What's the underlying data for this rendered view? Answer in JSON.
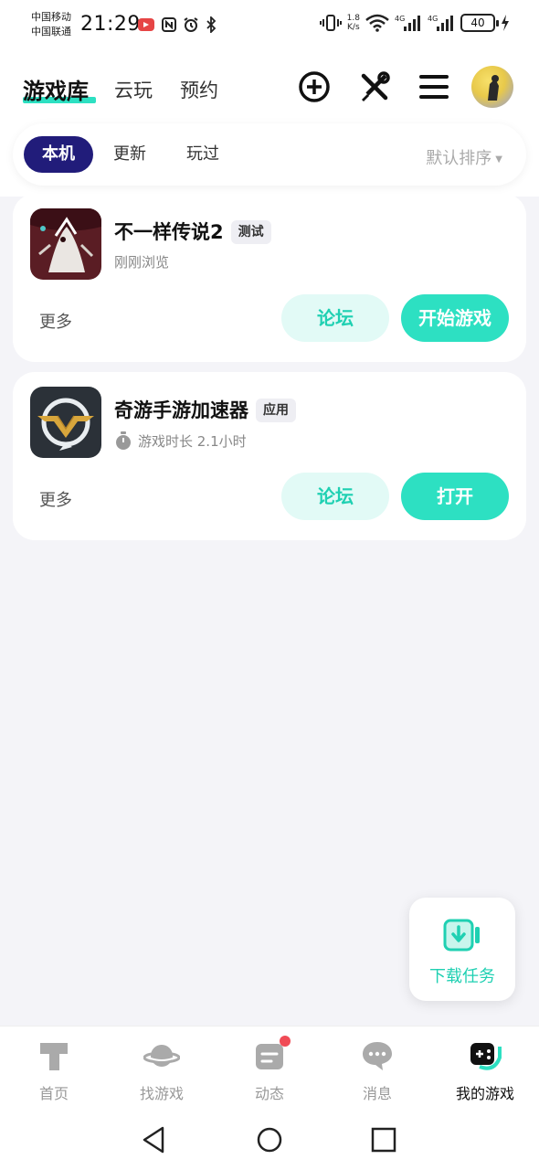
{
  "status_bar": {
    "carrier1": "中国移动",
    "carrier2": "中国联通",
    "time": "21:29",
    "net_speed_value": "1.8",
    "net_speed_unit": "K/s",
    "battery": "40"
  },
  "header": {
    "tabs": [
      {
        "label": "游戏库",
        "active": true
      },
      {
        "label": "云玩",
        "active": false
      },
      {
        "label": "预约",
        "active": false
      }
    ],
    "accent_color": "#2de0c2"
  },
  "filter": {
    "chips": [
      {
        "label": "本机",
        "active": true
      },
      {
        "label": "更新",
        "active": false
      },
      {
        "label": "玩过",
        "active": false
      }
    ],
    "sort_label": "默认排序"
  },
  "games": [
    {
      "title": "不一样传说2",
      "tag": "测试",
      "subtitle": "刚刚浏览",
      "more": "更多",
      "forum_label": "论坛",
      "primary_label": "开始游戏"
    },
    {
      "title": "奇游手游加速器",
      "tag": "应用",
      "subtitle": "游戏时长 2.1小时",
      "more": "更多",
      "forum_label": "论坛",
      "primary_label": "打开"
    }
  ],
  "download_task": {
    "label": "下载任务"
  },
  "bottom_nav": {
    "items": [
      {
        "label": "首页",
        "icon": "home-icon"
      },
      {
        "label": "找游戏",
        "icon": "planet-icon"
      },
      {
        "label": "动态",
        "icon": "feed-icon",
        "badge": true
      },
      {
        "label": "消息",
        "icon": "message-icon"
      },
      {
        "label": "我的游戏",
        "icon": "gamepad-icon",
        "active": true
      }
    ]
  }
}
